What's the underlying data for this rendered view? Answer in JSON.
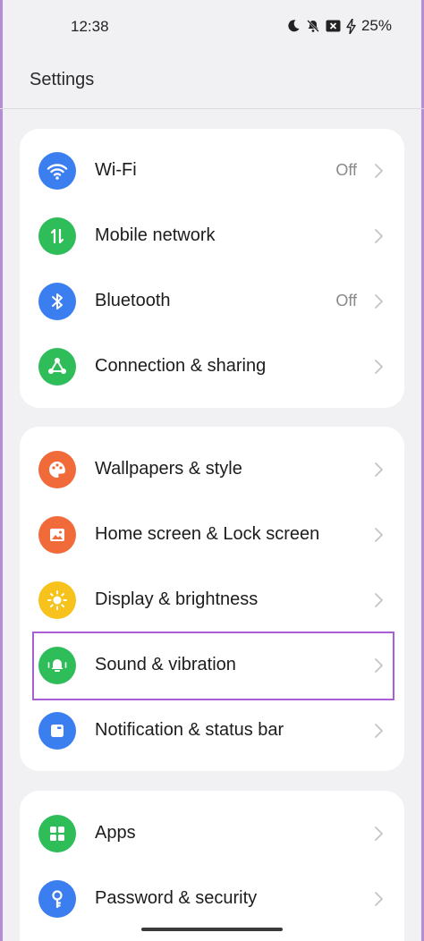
{
  "status_bar": {
    "time": "12:38",
    "battery": "25%",
    "icons": [
      "moon-icon",
      "bell-off-icon",
      "x-box-icon",
      "charging-bolt-icon"
    ]
  },
  "header": {
    "title": "Settings"
  },
  "cards": [
    {
      "items": [
        {
          "label": "Wi-Fi",
          "value": "Off",
          "icon": "wifi-icon",
          "color": "#3b7ef0"
        },
        {
          "label": "Mobile network",
          "value": "",
          "icon": "mobile-network-icon",
          "color": "#2fbd5a"
        },
        {
          "label": "Bluetooth",
          "value": "Off",
          "icon": "bluetooth-icon",
          "color": "#3b7ef0"
        },
        {
          "label": "Connection & sharing",
          "value": "",
          "icon": "connection-sharing-icon",
          "color": "#2fbd5a"
        }
      ]
    },
    {
      "items": [
        {
          "label": "Wallpapers & style",
          "value": "",
          "icon": "palette-icon",
          "color": "#f06a3a"
        },
        {
          "label": "Home screen & Lock screen",
          "value": "",
          "icon": "image-icon",
          "color": "#f06a3a"
        },
        {
          "label": "Display & brightness",
          "value": "",
          "icon": "sun-icon",
          "color": "#f7c21b"
        },
        {
          "label": "Sound & vibration",
          "value": "",
          "icon": "bell-vibrate-icon",
          "color": "#2fbd5a"
        },
        {
          "label": "Notification & status bar",
          "value": "",
          "icon": "notification-icon",
          "color": "#3b7ef0"
        }
      ]
    },
    {
      "items": [
        {
          "label": "Apps",
          "value": "",
          "icon": "apps-grid-icon",
          "color": "#2fbd5a"
        },
        {
          "label": "Password & security",
          "value": "",
          "icon": "key-icon",
          "color": "#3b7ef0"
        }
      ]
    }
  ]
}
